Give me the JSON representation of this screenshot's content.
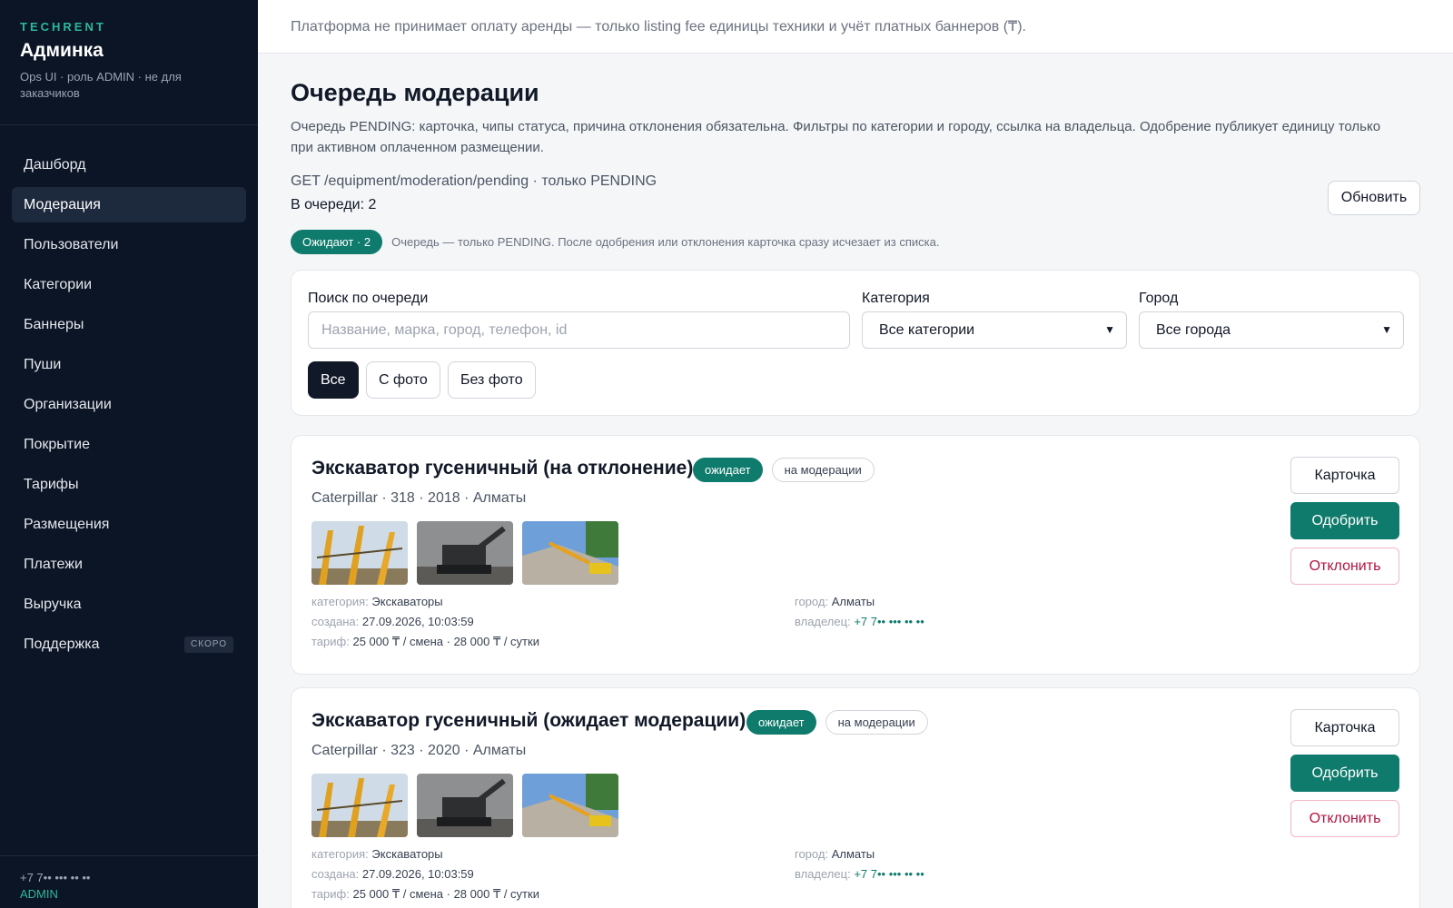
{
  "sidebar": {
    "brand": "TECHRENT",
    "title": "Админка",
    "subtitle": "Ops UI · роль ADMIN · не для заказчиков",
    "items": [
      {
        "label": "Дашборд",
        "active": false
      },
      {
        "label": "Модерация",
        "active": true
      },
      {
        "label": "Пользователи",
        "active": false
      },
      {
        "label": "Категории",
        "active": false
      },
      {
        "label": "Баннеры",
        "active": false
      },
      {
        "label": "Пуши",
        "active": false
      },
      {
        "label": "Организации",
        "active": false
      },
      {
        "label": "Покрытие",
        "active": false
      },
      {
        "label": "Тарифы",
        "active": false
      },
      {
        "label": "Размещения",
        "active": false
      },
      {
        "label": "Платежи",
        "active": false
      },
      {
        "label": "Выручка",
        "active": false
      },
      {
        "label": "Поддержка",
        "active": false,
        "badge": "СКОРО"
      }
    ],
    "footer": {
      "phone": "+7 7•• ••• •• ••",
      "role": "ADMIN"
    }
  },
  "topbar": {
    "notice": "Платформа не принимает оплату аренды — только listing fee единицы техники и учёт платных баннеров (₸)."
  },
  "page": {
    "title": "Очередь модерации",
    "description": "Очередь PENDING: карточка, чипы статуса, причина отклонения обязательна. Фильтры по категории и городу, ссылка на владельца. Одобрение публикует единицу только при активном оплаченном размещении.",
    "endpoint": "GET /equipment/moderation/pending · только PENDING",
    "queue_count": "В очереди: 2",
    "refresh_label": "Обновить",
    "waiting_pill": "Ожидают · 2",
    "waiting_note": "Очередь — только PENDING. После одобрения или отклонения карточка сразу исчезает из списка."
  },
  "filters": {
    "search_label": "Поиск по очереди",
    "search_placeholder": "Название, марка, город, телефон, id",
    "category_label": "Категория",
    "category_value": "Все категории",
    "city_label": "Город",
    "city_value": "Все города",
    "chips": [
      {
        "label": "Все",
        "active": true
      },
      {
        "label": "С фото",
        "active": false
      },
      {
        "label": "Без фото",
        "active": false
      }
    ]
  },
  "cards": [
    {
      "title": "Экскаватор гусеничный (на отклонение)",
      "status_badge": "ожидает",
      "moderation_badge": "на модерации",
      "subtitle": "Caterpillar · 318 · 2018 · Алматы",
      "category_key": "категория:",
      "category": "Экскаваторы",
      "created_key": "создана:",
      "created": "27.09.2026, 10:03:59",
      "tariff_key": "тариф:",
      "tariff": "25 000 ₸ / смена · 28 000 ₸ / сутки",
      "city_key": "город:",
      "city": "Алматы",
      "owner_key": "владелец:",
      "owner": "+7 7•• ••• •• ••",
      "btn_card": "Карточка",
      "btn_approve": "Одобрить",
      "btn_reject": "Отклонить"
    },
    {
      "title": "Экскаватор гусеничный (ожидает модерации)",
      "status_badge": "ожидает",
      "moderation_badge": "на модерации",
      "subtitle": "Caterpillar · 323 · 2020 · Алматы",
      "category_key": "категория:",
      "category": "Экскаваторы",
      "created_key": "создана:",
      "created": "27.09.2026, 10:03:59",
      "tariff_key": "тариф:",
      "tariff": "25 000 ₸ / смена · 28 000 ₸ / сутки",
      "city_key": "город:",
      "city": "Алматы",
      "owner_key": "владелец:",
      "owner": "+7 7•• ••• •• ••",
      "btn_card": "Карточка",
      "btn_approve": "Одобрить",
      "btn_reject": "Отклонить"
    }
  ],
  "colors": {
    "accent": "#0f7b6c",
    "sidebar_bg": "#0b1526",
    "danger": "#b3123f"
  },
  "icons": {
    "select_chevron": "chevron-down-icon"
  }
}
